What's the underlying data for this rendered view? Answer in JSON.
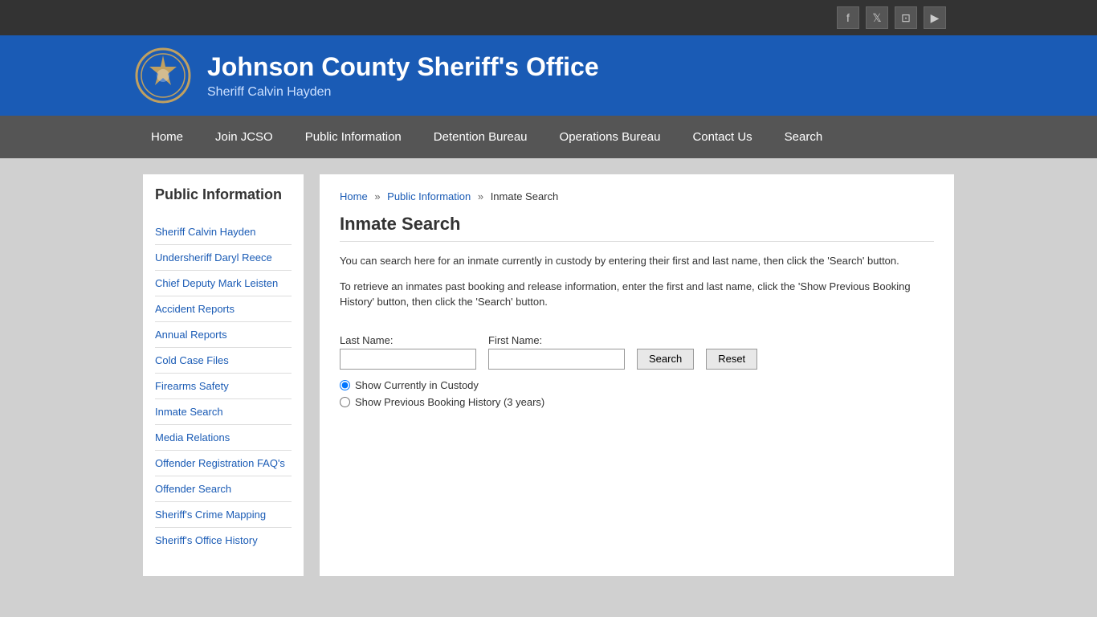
{
  "topbar": {
    "social_icons": [
      {
        "name": "facebook-icon",
        "symbol": "f"
      },
      {
        "name": "twitter-icon",
        "symbol": "t"
      },
      {
        "name": "instagram-icon",
        "symbol": "📷"
      },
      {
        "name": "youtube-icon",
        "symbol": "▶"
      }
    ]
  },
  "header": {
    "title": "Johnson County Sheriff's Office",
    "subtitle": "Sheriff Calvin Hayden",
    "badge_alt": "Sheriff Badge"
  },
  "nav": {
    "items": [
      {
        "label": "Home",
        "name": "nav-home"
      },
      {
        "label": "Join JCSO",
        "name": "nav-join-jcso"
      },
      {
        "label": "Public Information",
        "name": "nav-public-information"
      },
      {
        "label": "Detention Bureau",
        "name": "nav-detention-bureau"
      },
      {
        "label": "Operations Bureau",
        "name": "nav-operations-bureau"
      },
      {
        "label": "Contact Us",
        "name": "nav-contact-us"
      },
      {
        "label": "Search",
        "name": "nav-search"
      }
    ]
  },
  "sidebar": {
    "title": "Public Information",
    "links": [
      {
        "label": "Sheriff Calvin Hayden",
        "name": "sidebar-sheriff"
      },
      {
        "label": "Undersheriff Daryl Reece",
        "name": "sidebar-undersheriff"
      },
      {
        "label": "Chief Deputy Mark Leisten",
        "name": "sidebar-chief-deputy"
      },
      {
        "label": "Accident Reports",
        "name": "sidebar-accident-reports"
      },
      {
        "label": "Annual Reports",
        "name": "sidebar-annual-reports"
      },
      {
        "label": "Cold Case Files",
        "name": "sidebar-cold-case-files"
      },
      {
        "label": "Firearms Safety",
        "name": "sidebar-firearms-safety"
      },
      {
        "label": "Inmate Search",
        "name": "sidebar-inmate-search"
      },
      {
        "label": "Media Relations",
        "name": "sidebar-media-relations"
      },
      {
        "label": "Offender Registration FAQ's",
        "name": "sidebar-offender-faq"
      },
      {
        "label": "Offender Search",
        "name": "sidebar-offender-search"
      },
      {
        "label": "Sheriff's Crime Mapping",
        "name": "sidebar-crime-mapping"
      },
      {
        "label": "Sheriff's Office History",
        "name": "sidebar-office-history"
      }
    ]
  },
  "breadcrumb": {
    "home": "Home",
    "public_info": "Public Information",
    "current": "Inmate Search"
  },
  "content": {
    "page_title": "Inmate Search",
    "description_1": "You can search here for an inmate currently in custody by entering their first and last name, then click the 'Search' button.",
    "description_2": "To retrieve an inmates past booking and release information, enter the first and last name, click the 'Show Previous Booking History' button, then click the 'Search' button.",
    "form": {
      "last_name_label": "Last Name:",
      "first_name_label": "First Name:",
      "search_button": "Search",
      "reset_button": "Reset",
      "radio_custody": "Show Currently in Custody",
      "radio_history": "Show Previous Booking History (3 years)"
    }
  }
}
